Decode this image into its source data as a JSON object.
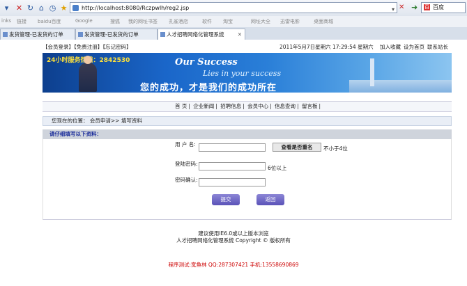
{
  "browser": {
    "url": "http://localhost:8080/Rczpwlh/reg2.jsp",
    "search_engine": "百度",
    "bookmarks": [
      "inks",
      "链接",
      "baidu百度",
      "Google",
      "搜狐",
      "我的网址书签",
      "孔雀酒店",
      "软件",
      "淘宝",
      "网址大全",
      "迅雷电影",
      "桌面商城"
    ],
    "tabs": [
      {
        "label": "发货管理-已发货的订单",
        "active": false
      },
      {
        "label": "发货管理-已发货的订单",
        "active": false
      },
      {
        "label": "人才招聘网络化管理系统",
        "active": true
      }
    ]
  },
  "site": {
    "top_links": "【会员登录】【免费注册】【忘记密码】",
    "datetime": "2011年5月7日星期六 17:29:54  星期六",
    "right_links": [
      "加入收藏",
      "设为首页",
      "联系站长"
    ],
    "banner": {
      "hotline": "24小时服务热线：2842530",
      "en_line1": "Our Success",
      "en_line2": "Lies in your success",
      "cn_slogan": "您的成功，才是我们的成功所在"
    },
    "nav": [
      "首 页",
      "企业新闻",
      "招聘信息",
      "会员中心",
      "信息查询",
      "留言板"
    ],
    "breadcrumb": "您现在的位置：  会员申请>> 填写资料",
    "section_title": "请仔细填写以下资料：",
    "form": {
      "username_label": "用 户 名:",
      "check_button": "查看是否重名",
      "username_hint": "不小于4位",
      "password_label": "登陆密码:",
      "password_hint": "6位以上",
      "confirm_label": "密码确认:",
      "submit": "提交",
      "back": "返回"
    },
    "footer_line1": "建议使用IE6.0或以上版本浏览",
    "footer_line2": "人才招聘网络化管理系统 Copyright © 版权所有",
    "test_note": "程序测试:宽鱼林 QQ:287307421 手机:13558690869"
  }
}
